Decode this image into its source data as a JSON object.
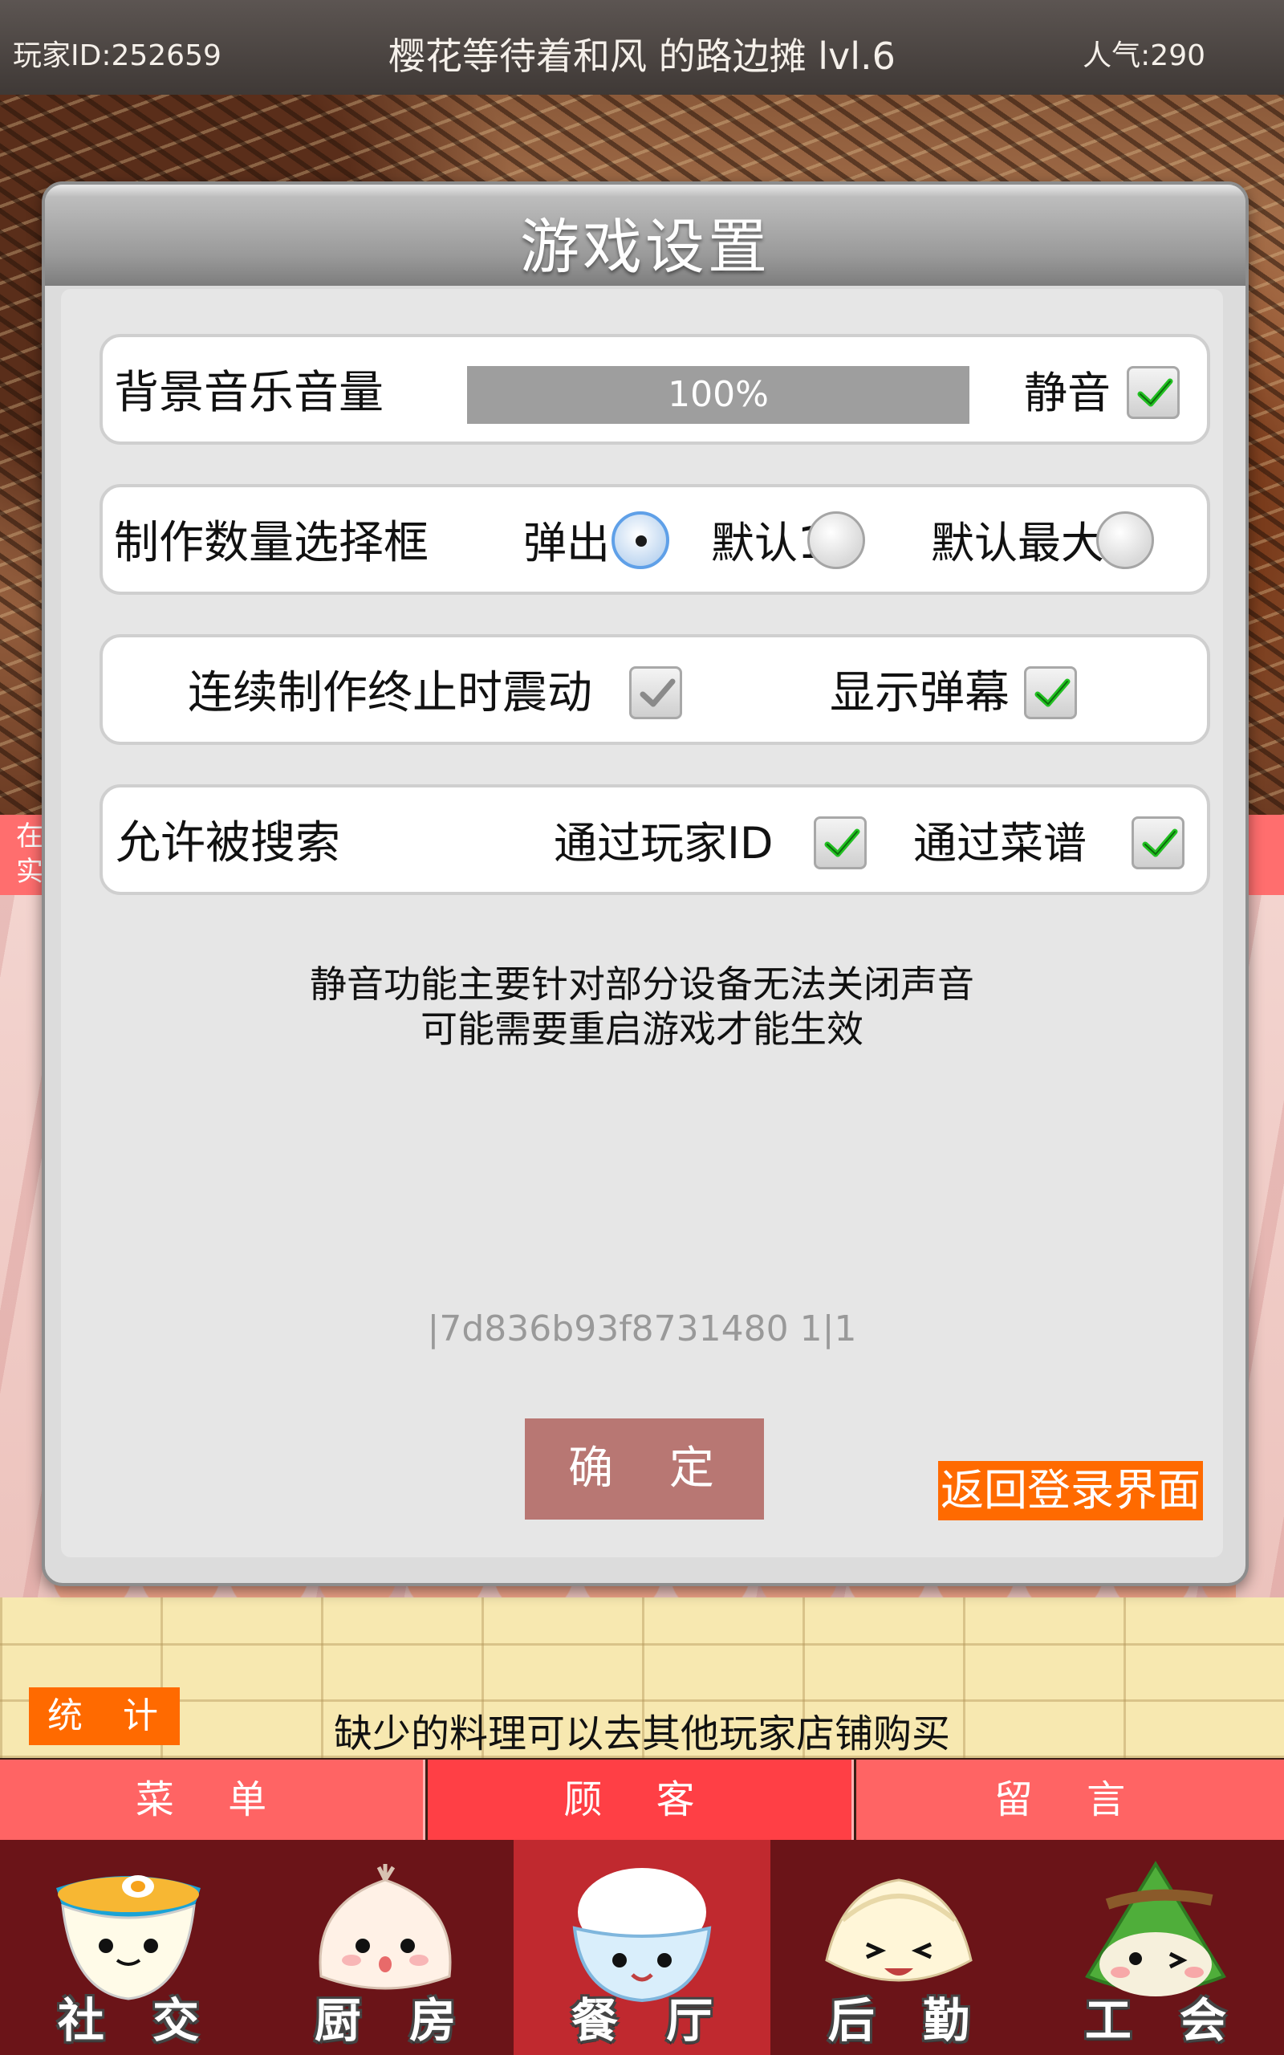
{
  "header": {
    "player_id": "玩家ID:252659",
    "shop_title": "樱花等待着和风 的路边摊 lvl.6",
    "popularity": "人气:290"
  },
  "background": {
    "side_text": "在\n实"
  },
  "settings": {
    "title": "游戏设置",
    "music": {
      "label": "背景音乐音量",
      "volume_text": "100%",
      "volume": 100,
      "mute_label": "静音",
      "mute_checked": true
    },
    "quantity": {
      "label": "制作数量选择框",
      "options": [
        {
          "label": "弹出",
          "selected": true
        },
        {
          "label": "默认1",
          "selected": false
        },
        {
          "label": "默认最大",
          "selected": false
        }
      ]
    },
    "vibration": {
      "label": "连续制作终止时震动",
      "checked": true,
      "danmaku_label": "显示弹幕",
      "danmaku_checked": true
    },
    "search": {
      "label": "允许被搜索",
      "by_id_label": "通过玩家ID",
      "by_id_checked": true,
      "by_recipe_label": "通过菜谱",
      "by_recipe_checked": true
    },
    "info_line1": "静音功能主要针对部分设备无法关闭声音",
    "info_line2": "可能需要重启游戏才能生效",
    "version": "|7d836b93f8731480  1|1",
    "ok_label": "确 定",
    "back_label": "返回登录界面"
  },
  "restaurant": {
    "stats_label": "统 计",
    "hint": "缺少的料理可以去其他玩家店铺购买"
  },
  "subtabs": [
    {
      "label": "菜 单",
      "active": false
    },
    {
      "label": "顾 客",
      "active": true
    },
    {
      "label": "留 言",
      "active": false
    }
  ],
  "nav": [
    {
      "label": "社 交",
      "icon": "noodle-bowl-icon",
      "active": false
    },
    {
      "label": "厨 房",
      "icon": "bun-icon",
      "active": false
    },
    {
      "label": "餐 厅",
      "icon": "rice-bowl-icon",
      "active": true
    },
    {
      "label": "后 勤",
      "icon": "dumpling-icon",
      "active": false
    },
    {
      "label": "工 会",
      "icon": "zongzi-icon",
      "active": false
    }
  ],
  "colors": {
    "accent_orange": "#ff6a00",
    "ok_button": "#b87773",
    "check_green": "#22c022",
    "nav_bg": "#6b1418",
    "nav_active": "#c0292f"
  }
}
